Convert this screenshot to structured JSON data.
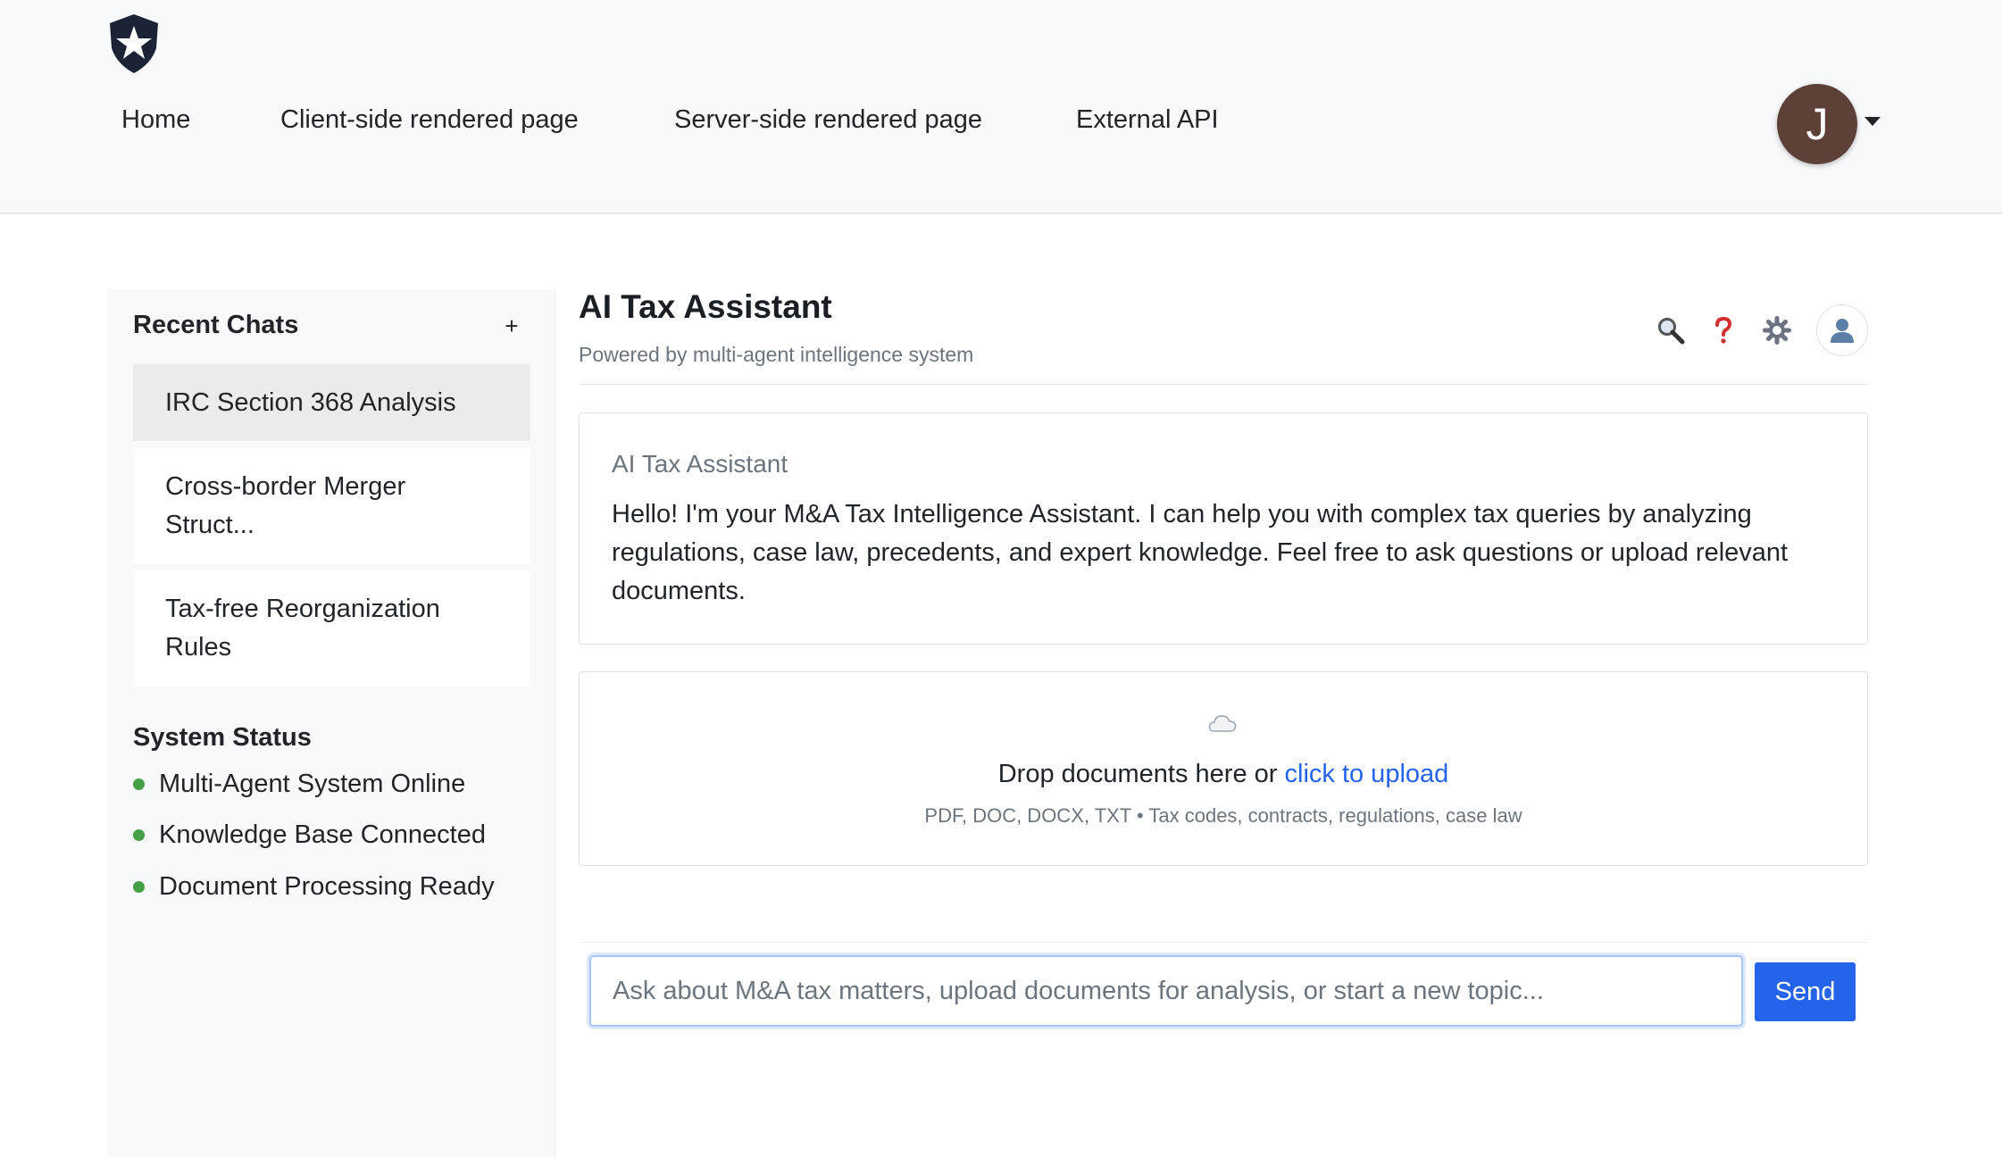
{
  "navbar": {
    "logo_icon": "shield-star-logo",
    "links": [
      "Home",
      "Client-side rendered page",
      "Server-side rendered page",
      "External API"
    ],
    "user_initial": "J",
    "user_avatar_color": "#5d4037"
  },
  "sidebar": {
    "recent_title": "Recent Chats",
    "new_chat_label": "+",
    "chats": [
      {
        "label": "IRC Section 368 Analysis",
        "active": true
      },
      {
        "label": "Cross-border Merger Struct...",
        "active": false
      },
      {
        "label": "Tax-free Reorganization Rules",
        "active": false
      }
    ],
    "status_title": "System Status",
    "status_color": "#43a047",
    "status_items": [
      "Multi-Agent System Online",
      "Knowledge Base Connected",
      "Document Processing Ready"
    ]
  },
  "main": {
    "title": "AI Tax Assistant",
    "subtitle": "Powered by multi-agent intelligence system",
    "toolbar_icons": [
      "search-icon",
      "help-icon",
      "settings-icon",
      "user-icon"
    ],
    "message": {
      "sender": "AI Tax Assistant",
      "text": "Hello! I'm your M&A Tax Intelligence Assistant. I can help you with complex tax queries by analyzing regulations, case law, precedents, and expert knowledge. Feel free to ask questions or upload relevant documents."
    },
    "upload": {
      "icon": "cloud-icon",
      "prefix": "Drop documents here or ",
      "link": "click to upload",
      "hint": "PDF, DOC, DOCX, TXT • Tax codes, contracts, regulations, case law"
    },
    "composer": {
      "placeholder": "Ask about M&A tax matters, upload documents for analysis, or start a new topic...",
      "value": "",
      "send_label": "Send",
      "accent_color": "#2563eb"
    }
  }
}
